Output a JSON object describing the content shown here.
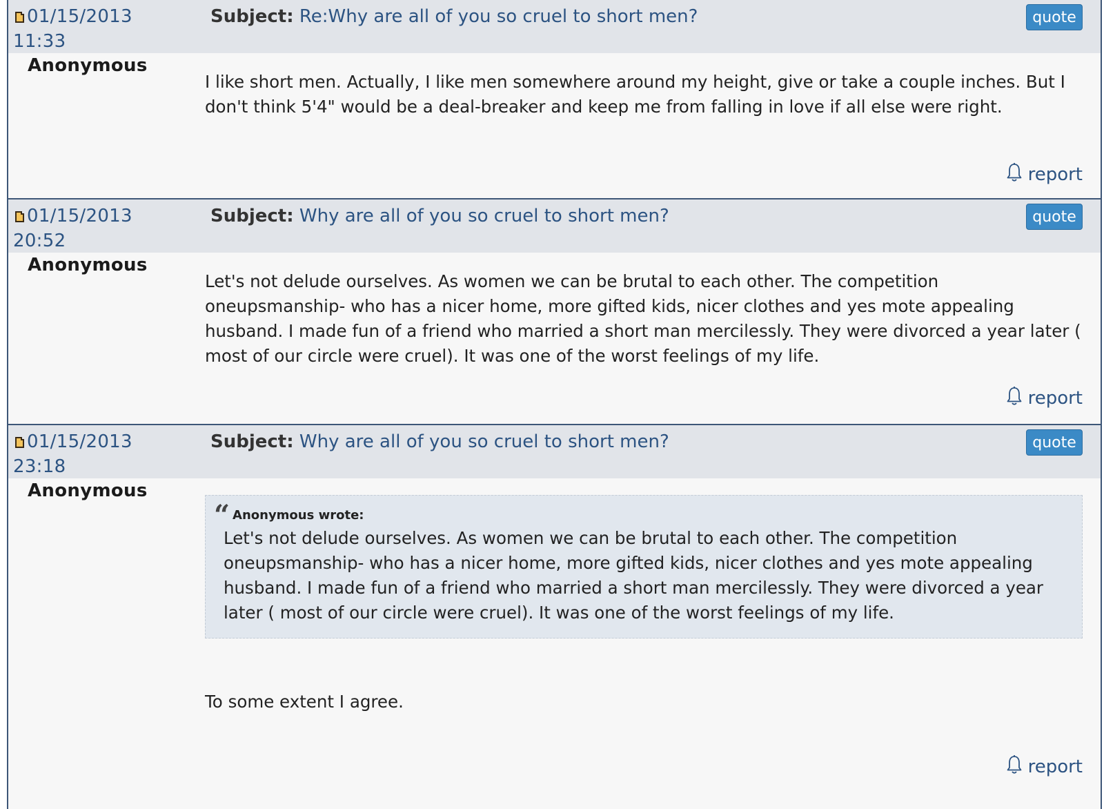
{
  "labels": {
    "subject": "Subject:",
    "quote_button": "quote",
    "report_link": "report"
  },
  "posts": [
    {
      "date": "01/15/2013",
      "time": "11:33",
      "subject": "Re:Why are all of you so cruel to short men?",
      "author": "Anonymous",
      "body": "I like short men. Actually, I like men somewhere around my height, give or take a couple inches. But I don't think 5'4\" would be a deal-breaker and keep me from falling in love if all else were right."
    },
    {
      "date": "01/15/2013",
      "time": "20:52",
      "subject": "Why are all of you so cruel to short men?",
      "author": "Anonymous",
      "body": "Let's not delude ourselves. As women we can be brutal to each other. The competition oneupsmanship- who has a nicer home, more gifted kids, nicer clothes and yes mote appealing husband. I made fun of a friend who married a short man mercilessly. They were divorced a year later ( most of our circle were cruel). It was one of the worst feelings of my life."
    },
    {
      "date": "01/15/2013",
      "time": "23:18",
      "subject": "Why are all of you so cruel to short men?",
      "author": "Anonymous",
      "quote": {
        "header": "Anonymous wrote:",
        "text": "Let's not delude ourselves. As women we can be brutal to each other. The competition oneupsmanship- who has a nicer home, more gifted kids, nicer clothes and yes mote appealing husband. I made fun of a friend who married a short man mercilessly. They were divorced a year later ( most of our circle were cruel). It was one of the worst feelings of my life."
      },
      "body": "To some extent I agree."
    }
  ],
  "colors": {
    "border": "#3d5677",
    "header_bg": "#e1e4e9",
    "link": "#2c5382",
    "quote_button": "#3b8ac6",
    "quote_block_bg": "#e1e7ee"
  },
  "icons": {
    "post": "document-icon",
    "report": "bell-icon",
    "quote": "quotation-mark-icon"
  }
}
